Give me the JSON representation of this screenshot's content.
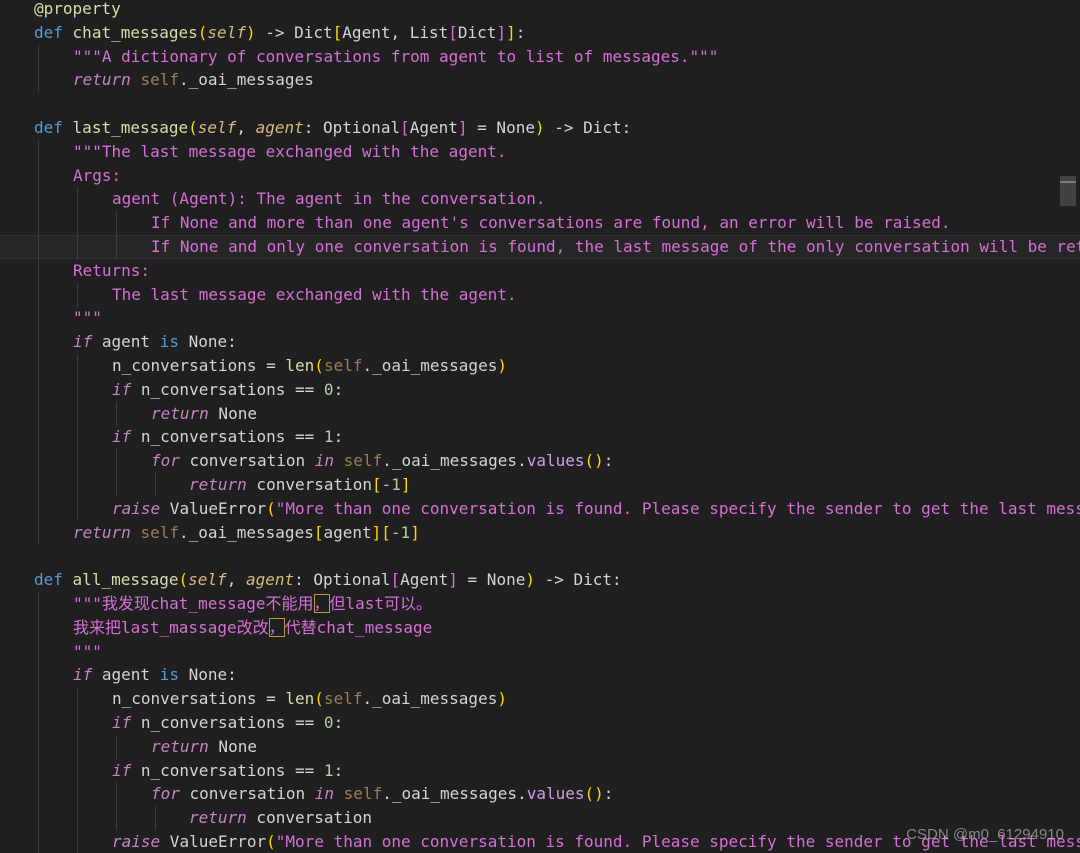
{
  "watermark": "CSDN @m0_61294910",
  "lines": [
    {
      "indent": 1,
      "tokens": [
        [
          "@property",
          "t-dec"
        ]
      ]
    },
    {
      "indent": 1,
      "tokens": [
        [
          "def",
          "t-kw"
        ],
        [
          " ",
          ""
        ],
        [
          "chat_messages",
          "t-fn"
        ],
        [
          "(",
          "t-br1"
        ],
        [
          "self",
          "t-selfp"
        ],
        [
          ")",
          "t-br1"
        ],
        [
          " -> Dict",
          "t-plain"
        ],
        [
          "[",
          "t-br1"
        ],
        [
          "Agent, List",
          "t-plain"
        ],
        [
          "[",
          "t-br2"
        ],
        [
          "Dict",
          "t-plain"
        ],
        [
          "]",
          "t-br2"
        ],
        [
          "]",
          "t-br1"
        ],
        [
          ":",
          "t-plain"
        ]
      ]
    },
    {
      "indent": 2,
      "tokens": [
        [
          "\"\"\"A dictionary of conversations from agent to list of messages.\"\"\"",
          "t-doc"
        ]
      ]
    },
    {
      "indent": 2,
      "tokens": [
        [
          "return",
          "t-ctl"
        ],
        [
          " ",
          ""
        ],
        [
          "self",
          "t-self"
        ],
        [
          "._oai_messages",
          "t-plain"
        ]
      ]
    },
    {
      "indent": 0,
      "tokens": []
    },
    {
      "indent": 1,
      "tokens": [
        [
          "def",
          "t-kw"
        ],
        [
          " ",
          ""
        ],
        [
          "last_message",
          "t-fn"
        ],
        [
          "(",
          "t-br1"
        ],
        [
          "self",
          "t-selfp"
        ],
        [
          ", ",
          "t-plain"
        ],
        [
          "agent",
          "t-param"
        ],
        [
          ": Optional",
          "t-plain"
        ],
        [
          "[",
          "t-br2"
        ],
        [
          "Agent",
          "t-plain"
        ],
        [
          "]",
          "t-br2"
        ],
        [
          " = None",
          "t-plain"
        ],
        [
          ")",
          "t-br1"
        ],
        [
          " -> Dict:",
          "t-plain"
        ]
      ]
    },
    {
      "indent": 2,
      "tokens": [
        [
          "\"\"\"The last message exchanged with the agent.",
          "t-doc"
        ]
      ]
    },
    {
      "indent": 2,
      "tokens": [
        [
          "Args:",
          "t-doc"
        ]
      ]
    },
    {
      "indent": 3,
      "tokens": [
        [
          "agent (Agent): The agent in the conversation.",
          "t-doc"
        ]
      ]
    },
    {
      "indent": 4,
      "tokens": [
        [
          "If None and more than one agent's conversations are found, an error will be raised.",
          "t-doc"
        ]
      ]
    },
    {
      "indent": 4,
      "current": true,
      "tokens": [
        [
          "If None and only one conversation is found, the last message of the only conversation will be returned.",
          "t-doc"
        ]
      ]
    },
    {
      "indent": 2,
      "tokens": [
        [
          "Returns:",
          "t-doc"
        ]
      ]
    },
    {
      "indent": 3,
      "tokens": [
        [
          "The last message exchanged with the agent.",
          "t-doc"
        ]
      ]
    },
    {
      "indent": 2,
      "tokens": [
        [
          "\"\"\"",
          "t-doc"
        ]
      ]
    },
    {
      "indent": 2,
      "tokens": [
        [
          "if",
          "t-ctl"
        ],
        [
          " agent ",
          "t-plain"
        ],
        [
          "is",
          "t-kw"
        ],
        [
          " None:",
          "t-plain"
        ]
      ]
    },
    {
      "indent": 3,
      "tokens": [
        [
          "n_conversations = ",
          "t-plain"
        ],
        [
          "len",
          "t-fn"
        ],
        [
          "(",
          "t-br1"
        ],
        [
          "self",
          "t-self"
        ],
        [
          "._oai_messages",
          "t-plain"
        ],
        [
          ")",
          "t-br1"
        ]
      ]
    },
    {
      "indent": 3,
      "tokens": [
        [
          "if",
          "t-ctl"
        ],
        [
          " n_conversations == ",
          "t-plain"
        ],
        [
          "0",
          "t-num"
        ],
        [
          ":",
          "t-plain"
        ]
      ]
    },
    {
      "indent": 4,
      "tokens": [
        [
          "return",
          "t-ctl"
        ],
        [
          " None",
          "t-plain"
        ]
      ]
    },
    {
      "indent": 3,
      "tokens": [
        [
          "if",
          "t-ctl"
        ],
        [
          " n_conversations == ",
          "t-plain"
        ],
        [
          "1",
          "t-num"
        ],
        [
          ":",
          "t-plain"
        ]
      ]
    },
    {
      "indent": 4,
      "tokens": [
        [
          "for",
          "t-ctl"
        ],
        [
          " conversation ",
          "t-plain"
        ],
        [
          "in",
          "t-ctl"
        ],
        [
          " ",
          ""
        ],
        [
          "self",
          "t-self"
        ],
        [
          "._oai_messages.",
          "t-plain"
        ],
        [
          "values",
          "t-method"
        ],
        [
          "()",
          "t-br1"
        ],
        [
          ":",
          "t-plain"
        ]
      ]
    },
    {
      "indent": 5,
      "tokens": [
        [
          "return",
          "t-ctl"
        ],
        [
          " conversation",
          "t-plain"
        ],
        [
          "[",
          "t-br1"
        ],
        [
          "-1",
          "t-num"
        ],
        [
          "]",
          "t-br1"
        ]
      ]
    },
    {
      "indent": 3,
      "tokens": [
        [
          "raise",
          "t-ctl"
        ],
        [
          " ValueError",
          "t-plain"
        ],
        [
          "(",
          "t-br1"
        ],
        [
          "\"More than one conversation is found. Please specify the sender to get the last message.\"",
          "t-doc"
        ],
        [
          ")",
          "t-br1"
        ]
      ]
    },
    {
      "indent": 2,
      "tokens": [
        [
          "return",
          "t-ctl"
        ],
        [
          " ",
          ""
        ],
        [
          "self",
          "t-self"
        ],
        [
          "._oai_messages",
          "t-plain"
        ],
        [
          "[",
          "t-br1"
        ],
        [
          "agent",
          "t-plain"
        ],
        [
          "]",
          "t-br1"
        ],
        [
          "[",
          "t-br1"
        ],
        [
          "-1",
          "t-num"
        ],
        [
          "]",
          "t-br1"
        ]
      ]
    },
    {
      "indent": 0,
      "tokens": []
    },
    {
      "indent": 1,
      "tokens": [
        [
          "def",
          "t-kw"
        ],
        [
          " ",
          ""
        ],
        [
          "all_message",
          "t-fn"
        ],
        [
          "(",
          "t-br1"
        ],
        [
          "self",
          "t-selfp"
        ],
        [
          ", ",
          "t-plain"
        ],
        [
          "agent",
          "t-param"
        ],
        [
          ": Optional",
          "t-plain"
        ],
        [
          "[",
          "t-br2"
        ],
        [
          "Agent",
          "t-plain"
        ],
        [
          "]",
          "t-br2"
        ],
        [
          " = None",
          "t-plain"
        ],
        [
          ")",
          "t-br1"
        ],
        [
          " -> Dict:",
          "t-plain"
        ]
      ]
    },
    {
      "indent": 2,
      "tokens": [
        [
          "\"\"\"我发现chat_message不能用",
          "t-doc"
        ],
        [
          "，",
          "t-doc hl-box"
        ],
        [
          "但last可以。",
          "t-doc"
        ]
      ]
    },
    {
      "indent": 2,
      "tokens": [
        [
          "我来把last_massage改改",
          "t-doc"
        ],
        [
          "，",
          "t-doc hl-box"
        ],
        [
          "代替chat_message",
          "t-doc"
        ]
      ]
    },
    {
      "indent": 2,
      "tokens": [
        [
          "\"\"\"",
          "t-doc"
        ]
      ]
    },
    {
      "indent": 2,
      "tokens": [
        [
          "if",
          "t-ctl"
        ],
        [
          " agent ",
          "t-plain"
        ],
        [
          "is",
          "t-kw"
        ],
        [
          " None:",
          "t-plain"
        ]
      ]
    },
    {
      "indent": 3,
      "tokens": [
        [
          "n_conversations = ",
          "t-plain"
        ],
        [
          "len",
          "t-fn"
        ],
        [
          "(",
          "t-br1"
        ],
        [
          "self",
          "t-self"
        ],
        [
          "._oai_messages",
          "t-plain"
        ],
        [
          ")",
          "t-br1"
        ]
      ]
    },
    {
      "indent": 3,
      "tokens": [
        [
          "if",
          "t-ctl"
        ],
        [
          " n_conversations == ",
          "t-plain"
        ],
        [
          "0",
          "t-num"
        ],
        [
          ":",
          "t-plain"
        ]
      ]
    },
    {
      "indent": 4,
      "tokens": [
        [
          "return",
          "t-ctl"
        ],
        [
          " None",
          "t-plain"
        ]
      ]
    },
    {
      "indent": 3,
      "tokens": [
        [
          "if",
          "t-ctl"
        ],
        [
          " n_conversations == ",
          "t-plain"
        ],
        [
          "1",
          "t-num"
        ],
        [
          ":",
          "t-plain"
        ]
      ]
    },
    {
      "indent": 4,
      "tokens": [
        [
          "for",
          "t-ctl"
        ],
        [
          " conversation ",
          "t-plain"
        ],
        [
          "in",
          "t-ctl"
        ],
        [
          " ",
          ""
        ],
        [
          "self",
          "t-self"
        ],
        [
          "._oai_messages.",
          "t-plain"
        ],
        [
          "values",
          "t-method"
        ],
        [
          "()",
          "t-br1"
        ],
        [
          ":",
          "t-plain"
        ]
      ]
    },
    {
      "indent": 5,
      "tokens": [
        [
          "return",
          "t-ctl"
        ],
        [
          " conversation",
          "t-plain"
        ]
      ]
    },
    {
      "indent": 3,
      "tokens": [
        [
          "raise",
          "t-ctl"
        ],
        [
          " ValueError",
          "t-plain"
        ],
        [
          "(",
          "t-br1"
        ],
        [
          "\"More than one conversation is found. Please specify the sender to get the last message.\"",
          "t-doc"
        ],
        [
          ")",
          "t-br1"
        ]
      ]
    }
  ]
}
